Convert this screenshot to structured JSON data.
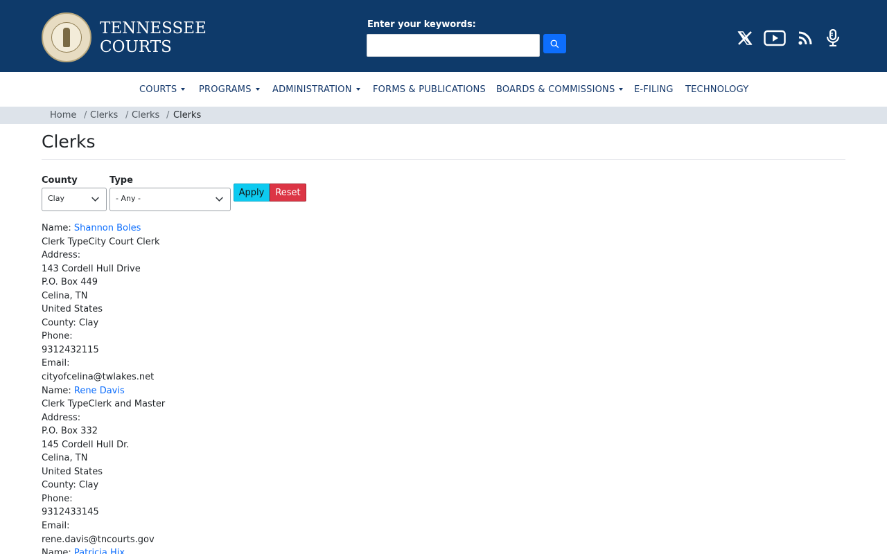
{
  "header": {
    "brand_line1": "TENNESSEE",
    "brand_line2": "COURTS",
    "search_label": "Enter your keywords:",
    "search_value": "",
    "social_icons": [
      "x-icon",
      "youtube-icon",
      "rss-icon",
      "podcast-microphone-icon"
    ]
  },
  "nav": {
    "items": [
      {
        "label": "COURTS",
        "dropdown": true
      },
      {
        "label": "PROGRAMS",
        "dropdown": true
      },
      {
        "label": "ADMINISTRATION",
        "dropdown": true
      },
      {
        "label": "FORMS & PUBLICATIONS",
        "dropdown": false
      },
      {
        "label": "BOARDS & COMMISSIONS",
        "dropdown": true
      },
      {
        "label": "E-FILING",
        "dropdown": false
      },
      {
        "label": "TECHNOLOGY",
        "dropdown": false
      }
    ]
  },
  "breadcrumb": [
    "Home",
    "Clerks",
    "Clerks",
    "Clerks"
  ],
  "page": {
    "title": "Clerks"
  },
  "filters": {
    "county_label": "County",
    "county_value": "Clay",
    "type_label": "Type",
    "type_value": "- Any -",
    "apply_label": "Apply",
    "reset_label": "Reset"
  },
  "results": [
    {
      "name_prefix": "Name: ",
      "name": "Shannon Boles",
      "clerk_type": "Clerk TypeCity Court Clerk",
      "address_label": "Address:",
      "address_lines": [
        "143 Cordell Hull Drive",
        "P.O. Box 449",
        "Celina, TN",
        "United States"
      ],
      "county": "County: Clay",
      "phone_label": "Phone:",
      "phone": "9312432115",
      "email_label": "Email:",
      "email": "cityofcelina@twlakes.net"
    },
    {
      "name_prefix": "Name: ",
      "name": "Rene Davis",
      "clerk_type": "Clerk TypeClerk and Master",
      "address_label": "Address:",
      "address_lines": [
        "P.O. Box 332",
        "145 Cordell Hull Dr.",
        "Celina, TN",
        "United States"
      ],
      "county": "County: Clay",
      "phone_label": "Phone:",
      "phone": "9312433145",
      "email_label": "Email:",
      "email": "rene.davis@tncourts.gov"
    },
    {
      "name_prefix": "Name: ",
      "name": "Patricia Hix"
    }
  ],
  "colors": {
    "header_bg": "#0e3a6a",
    "nav_text": "#14386b",
    "link": "#0d6efd",
    "apply_btn": "#0dcaf0",
    "reset_btn": "#dc3545"
  }
}
